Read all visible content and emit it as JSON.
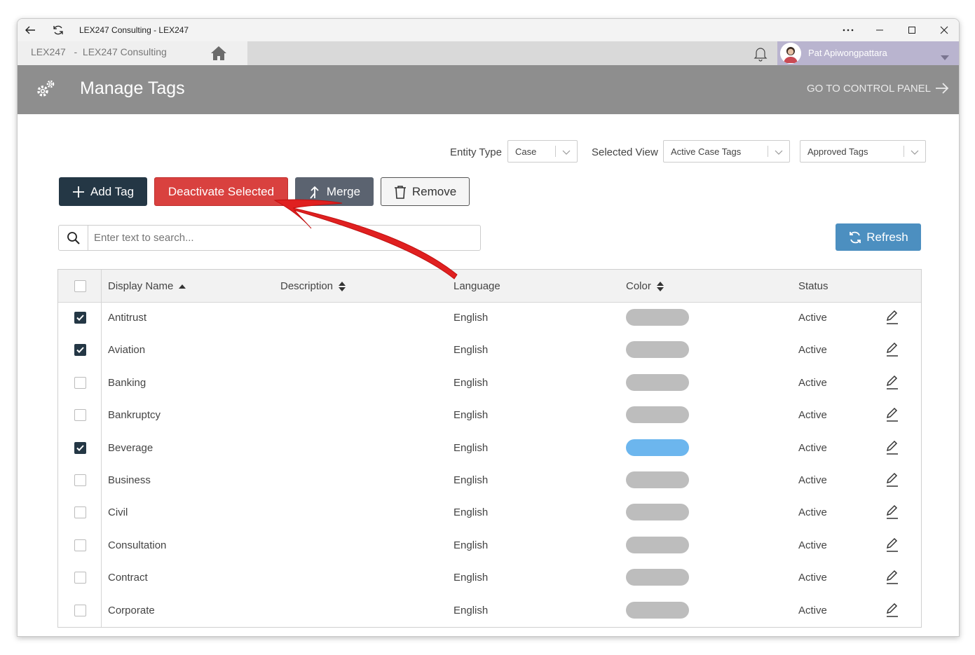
{
  "window": {
    "title": "LEX247 Consulting - LEX247",
    "controls": [
      "more-icon",
      "minimize-icon",
      "maximize-icon",
      "close-icon"
    ]
  },
  "tabbar": {
    "tab_label": "LEX247   -  LEX247 Consulting",
    "user_name": "Pat Apiwongpattara"
  },
  "header": {
    "title": "Manage Tags",
    "control_panel_link": "GO TO CONTROL PANEL"
  },
  "filters": {
    "entity_type_label": "Entity Type",
    "entity_type_value": "Case",
    "selected_view_label": "Selected View",
    "selected_view_value": "Active Case Tags",
    "approval_value": "Approved Tags"
  },
  "toolbar": {
    "add_label": "Add Tag",
    "deactivate_label": "Deactivate Selected",
    "merge_label": "Merge",
    "remove_label": "Remove",
    "refresh_label": "Refresh"
  },
  "search": {
    "placeholder": "Enter text to search..."
  },
  "table": {
    "columns": [
      "Display Name",
      "Description",
      "Language",
      "Color",
      "Status"
    ],
    "rows": [
      {
        "name": "Antitrust",
        "description": "",
        "language": "English",
        "color": "#bdbdbd",
        "status": "Active",
        "checked": true
      },
      {
        "name": "Aviation",
        "description": "",
        "language": "English",
        "color": "#bdbdbd",
        "status": "Active",
        "checked": true
      },
      {
        "name": "Banking",
        "description": "",
        "language": "English",
        "color": "#bdbdbd",
        "status": "Active",
        "checked": false
      },
      {
        "name": "Bankruptcy",
        "description": "",
        "language": "English",
        "color": "#bdbdbd",
        "status": "Active",
        "checked": false
      },
      {
        "name": "Beverage",
        "description": "",
        "language": "English",
        "color": "#6cb6ee",
        "status": "Active",
        "checked": true
      },
      {
        "name": "Business",
        "description": "",
        "language": "English",
        "color": "#bdbdbd",
        "status": "Active",
        "checked": false
      },
      {
        "name": "Civil",
        "description": "",
        "language": "English",
        "color": "#bdbdbd",
        "status": "Active",
        "checked": false
      },
      {
        "name": "Consultation",
        "description": "",
        "language": "English",
        "color": "#bdbdbd",
        "status": "Active",
        "checked": false
      },
      {
        "name": "Contract",
        "description": "",
        "language": "English",
        "color": "#bdbdbd",
        "status": "Active",
        "checked": false
      },
      {
        "name": "Corporate",
        "description": "",
        "language": "English",
        "color": "#bdbdbd",
        "status": "Active",
        "checked": false
      }
    ]
  },
  "colors": {
    "header_bg": "#8e8e8e",
    "add_btn": "#243745",
    "deactivate_btn": "#d9413f",
    "merge_btn": "#5b6370",
    "refresh_btn": "#4c8fc0",
    "annotation_arrow": "#e02020"
  }
}
